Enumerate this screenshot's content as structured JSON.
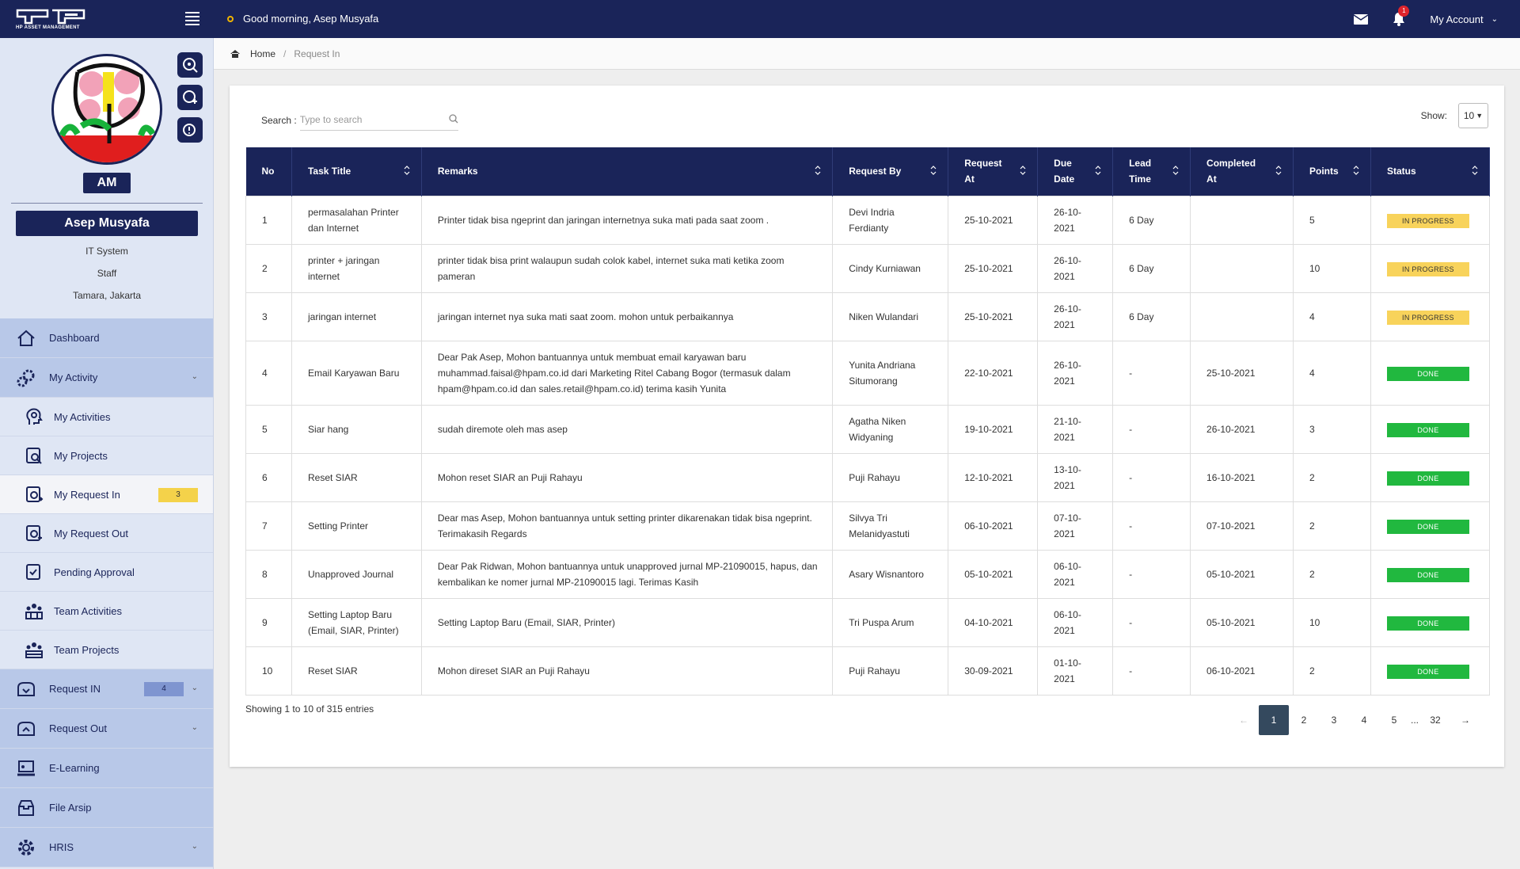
{
  "app": {
    "logo_sub": "HP ASSET MANAGEMENT",
    "greeting": "Good morning, Asep Musyafa",
    "account_label": "My Account",
    "notification_count": "1"
  },
  "profile": {
    "initials": "AM",
    "name": "Asep Musyafa",
    "department": "IT System",
    "role": "Staff",
    "location": "Tamara, Jakarta"
  },
  "nav": {
    "dashboard": "Dashboard",
    "my_activity": "My Activity",
    "my_activities": "My Activities",
    "my_projects": "My Projects",
    "my_request_in": "My Request In",
    "my_request_in_count": "3",
    "my_request_out": "My Request Out",
    "pending_approval": "Pending Approval",
    "team_activities": "Team Activities",
    "team_projects": "Team Projects",
    "request_in": "Request IN",
    "request_in_count": "4",
    "request_out": "Request Out",
    "elearning": "E-Learning",
    "file_arsip": "File Arsip",
    "hris": "HRIS"
  },
  "breadcrumb": {
    "home": "Home",
    "sep": "/",
    "current": "Request In"
  },
  "search": {
    "label": "Search :",
    "placeholder": "Type to search"
  },
  "show": {
    "label": "Show:",
    "value": "10"
  },
  "table": {
    "headers": [
      "No",
      "Task Title",
      "Remarks",
      "Request By",
      "Request At",
      "Due Date",
      "Lead Time",
      "Completed At",
      "Points",
      "Status"
    ],
    "rows": [
      {
        "no": "1",
        "title": "permasalahan Printer dan Internet",
        "remarks": "Printer tidak bisa ngeprint dan jaringan internetnya suka mati pada saat zoom .",
        "by": "Devi Indria Ferdianty",
        "at": "25-10-2021",
        "due": "26-10-2021",
        "lead": "6 Day",
        "completed": "",
        "points": "5",
        "status": "IN PROGRESS"
      },
      {
        "no": "2",
        "title": "printer + jaringan internet",
        "remarks": "printer tidak bisa print walaupun sudah colok kabel, internet suka mati ketika zoom pameran",
        "by": "Cindy Kurniawan",
        "at": "25-10-2021",
        "due": "26-10-2021",
        "lead": "6 Day",
        "completed": "",
        "points": "10",
        "status": "IN PROGRESS"
      },
      {
        "no": "3",
        "title": "jaringan internet",
        "remarks": "jaringan internet nya suka mati saat zoom. mohon untuk perbaikannya",
        "by": "Niken Wulandari",
        "at": "25-10-2021",
        "due": "26-10-2021",
        "lead": "6 Day",
        "completed": "",
        "points": "4",
        "status": "IN PROGRESS"
      },
      {
        "no": "4",
        "title": "Email Karyawan Baru",
        "remarks": "Dear Pak Asep, Mohon bantuannya untuk membuat email karyawan baru muhammad.faisal@hpam.co.id dari Marketing Ritel Cabang Bogor (termasuk dalam hpam@hpam.co.id dan sales.retail@hpam.co.id) terima kasih Yunita",
        "by": "Yunita Andriana Situmorang",
        "at": "22-10-2021",
        "due": "26-10-2021",
        "lead": "-",
        "completed": "25-10-2021",
        "points": "4",
        "status": "DONE"
      },
      {
        "no": "5",
        "title": "Siar hang",
        "remarks": "sudah diremote oleh mas asep",
        "by": "Agatha Niken Widyaning",
        "at": "19-10-2021",
        "due": "21-10-2021",
        "lead": "-",
        "completed": "26-10-2021",
        "points": "3",
        "status": "DONE"
      },
      {
        "no": "6",
        "title": "Reset SIAR",
        "remarks": "Mohon reset SIAR an Puji Rahayu",
        "by": "Puji Rahayu",
        "at": "12-10-2021",
        "due": "13-10-2021",
        "lead": "-",
        "completed": "16-10-2021",
        "points": "2",
        "status": "DONE"
      },
      {
        "no": "7",
        "title": "Setting Printer",
        "remarks": "Dear mas Asep, Mohon bantuannya untuk setting printer dikarenakan tidak bisa ngeprint. Terimakasih Regards",
        "by": "Silvya Tri Melanidyastuti",
        "at": "06-10-2021",
        "due": "07-10-2021",
        "lead": "-",
        "completed": "07-10-2021",
        "points": "2",
        "status": "DONE"
      },
      {
        "no": "8",
        "title": "Unapproved Journal",
        "remarks": "Dear Pak Ridwan, Mohon bantuannya untuk unapproved jurnal MP-21090015, hapus, dan kembalikan ke nomer jurnal MP-21090015 lagi. Terimas Kasih",
        "by": "Asary Wisnantoro",
        "at": "05-10-2021",
        "due": "06-10-2021",
        "lead": "-",
        "completed": "05-10-2021",
        "points": "2",
        "status": "DONE"
      },
      {
        "no": "9",
        "title": "Setting Laptop Baru (Email, SIAR, Printer)",
        "remarks": "Setting Laptop Baru (Email, SIAR, Printer)",
        "by": "Tri Puspa Arum",
        "at": "04-10-2021",
        "due": "06-10-2021",
        "lead": "-",
        "completed": "05-10-2021",
        "points": "10",
        "status": "DONE"
      },
      {
        "no": "10",
        "title": "Reset SIAR",
        "remarks": "Mohon direset SIAR an Puji Rahayu",
        "by": "Puji Rahayu",
        "at": "30-09-2021",
        "due": "01-10-2021",
        "lead": "-",
        "completed": "06-10-2021",
        "points": "2",
        "status": "DONE"
      }
    ]
  },
  "footer": {
    "info": "Showing 1 to 10 of 315 entries",
    "prev": "←",
    "pages": [
      "1",
      "2",
      "3",
      "4",
      "5"
    ],
    "ellipsis": "...",
    "last": "32",
    "next": "→"
  },
  "colors": {
    "navy": "#1a2459",
    "progress": "#f8d35b",
    "done": "#21b83f"
  }
}
